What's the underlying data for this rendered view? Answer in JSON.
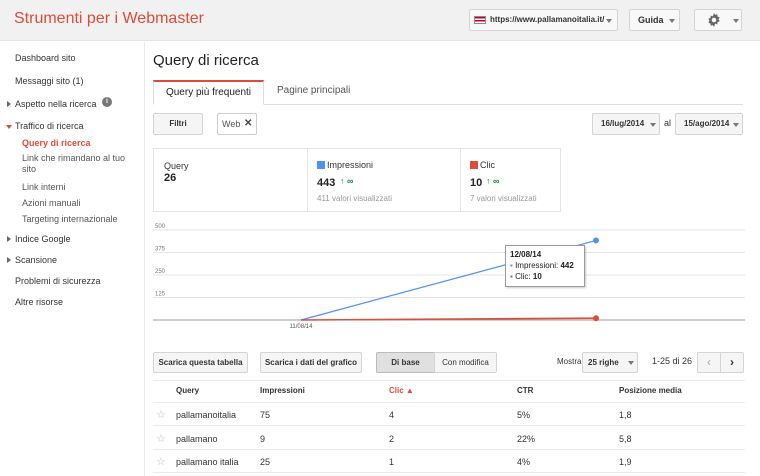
{
  "header": {
    "title": "Strumenti per i Webmaster",
    "site": "https://www.pallamanoitalia.it/",
    "help": "Guida"
  },
  "sidebar": {
    "items": [
      {
        "label": "Dashboard sito"
      },
      {
        "label": "Messaggi sito (1)"
      },
      {
        "label": "Aspetto nella ricerca"
      },
      {
        "label": "Traffico di ricerca"
      },
      {
        "label": "Query di ricerca"
      },
      {
        "label": "Link che rimandano al tuo sito"
      },
      {
        "label": "Link interni"
      },
      {
        "label": "Azioni manuali"
      },
      {
        "label": "Targeting internazionale"
      },
      {
        "label": "Indice Google"
      },
      {
        "label": "Scansione"
      },
      {
        "label": "Problemi di sicurezza"
      },
      {
        "label": "Altre risorse"
      }
    ]
  },
  "main": {
    "title": "Query di ricerca",
    "tabs": [
      {
        "label": "Query più frequenti"
      },
      {
        "label": "Pagine principali"
      }
    ],
    "filter_label": "Filtri",
    "filter_chip": "Web",
    "date_from": "16/lug/2014",
    "date_sep": "al",
    "date_to": "15/ago/2014"
  },
  "summary": {
    "query_label": "Query",
    "query_value": "26",
    "impressions_label": "Impressioni",
    "impressions_value": "443",
    "impressions_change": "↑ ∞",
    "impressions_sub": "411 valori visualizzati",
    "clicks_label": "Clic",
    "clicks_value": "10",
    "clicks_change": "↑ ∞",
    "clicks_sub": "7 valori visualizzati",
    "colors": {
      "impressions": "#4d90fe",
      "clicks": "#dd4b39"
    }
  },
  "chart_data": {
    "type": "line",
    "x": [
      "11/08/14",
      "12/08/14"
    ],
    "x_tick_labels": [
      "11/08/14"
    ],
    "y_ticks": [
      "500",
      "375",
      "250",
      "125"
    ],
    "ylim": [
      0,
      500
    ],
    "series": [
      {
        "name": "Impressioni",
        "values": [
          0,
          442
        ],
        "color": "#4d90fe"
      },
      {
        "name": "Clic",
        "values": [
          0,
          10
        ],
        "color": "#dd4b39"
      }
    ],
    "tooltip": {
      "date": "12/08/14",
      "impressions_label": "Impressioni:",
      "impressions_value": "442",
      "clicks_label": "Clic:",
      "clicks_value": "10"
    }
  },
  "table_controls": {
    "download_table": "Scarica questa tabella",
    "download_chart": "Scarica i dati del grafico",
    "basic": "Di base",
    "with_changes": "Con modifica",
    "show_label": "Mostra",
    "rows": "25 righe",
    "range": "1-25 di 26"
  },
  "table": {
    "headers": [
      "Query",
      "Impressioni",
      "Clic ▲",
      "CTR",
      "Posizione media"
    ],
    "rows": [
      [
        "pallamanoitalia",
        "75",
        "4",
        "5%",
        "1,8"
      ],
      [
        "pallamano",
        "9",
        "2",
        "22%",
        "5,8"
      ],
      [
        "pallamano italia",
        "25",
        "1",
        "4%",
        "1,9"
      ]
    ]
  }
}
